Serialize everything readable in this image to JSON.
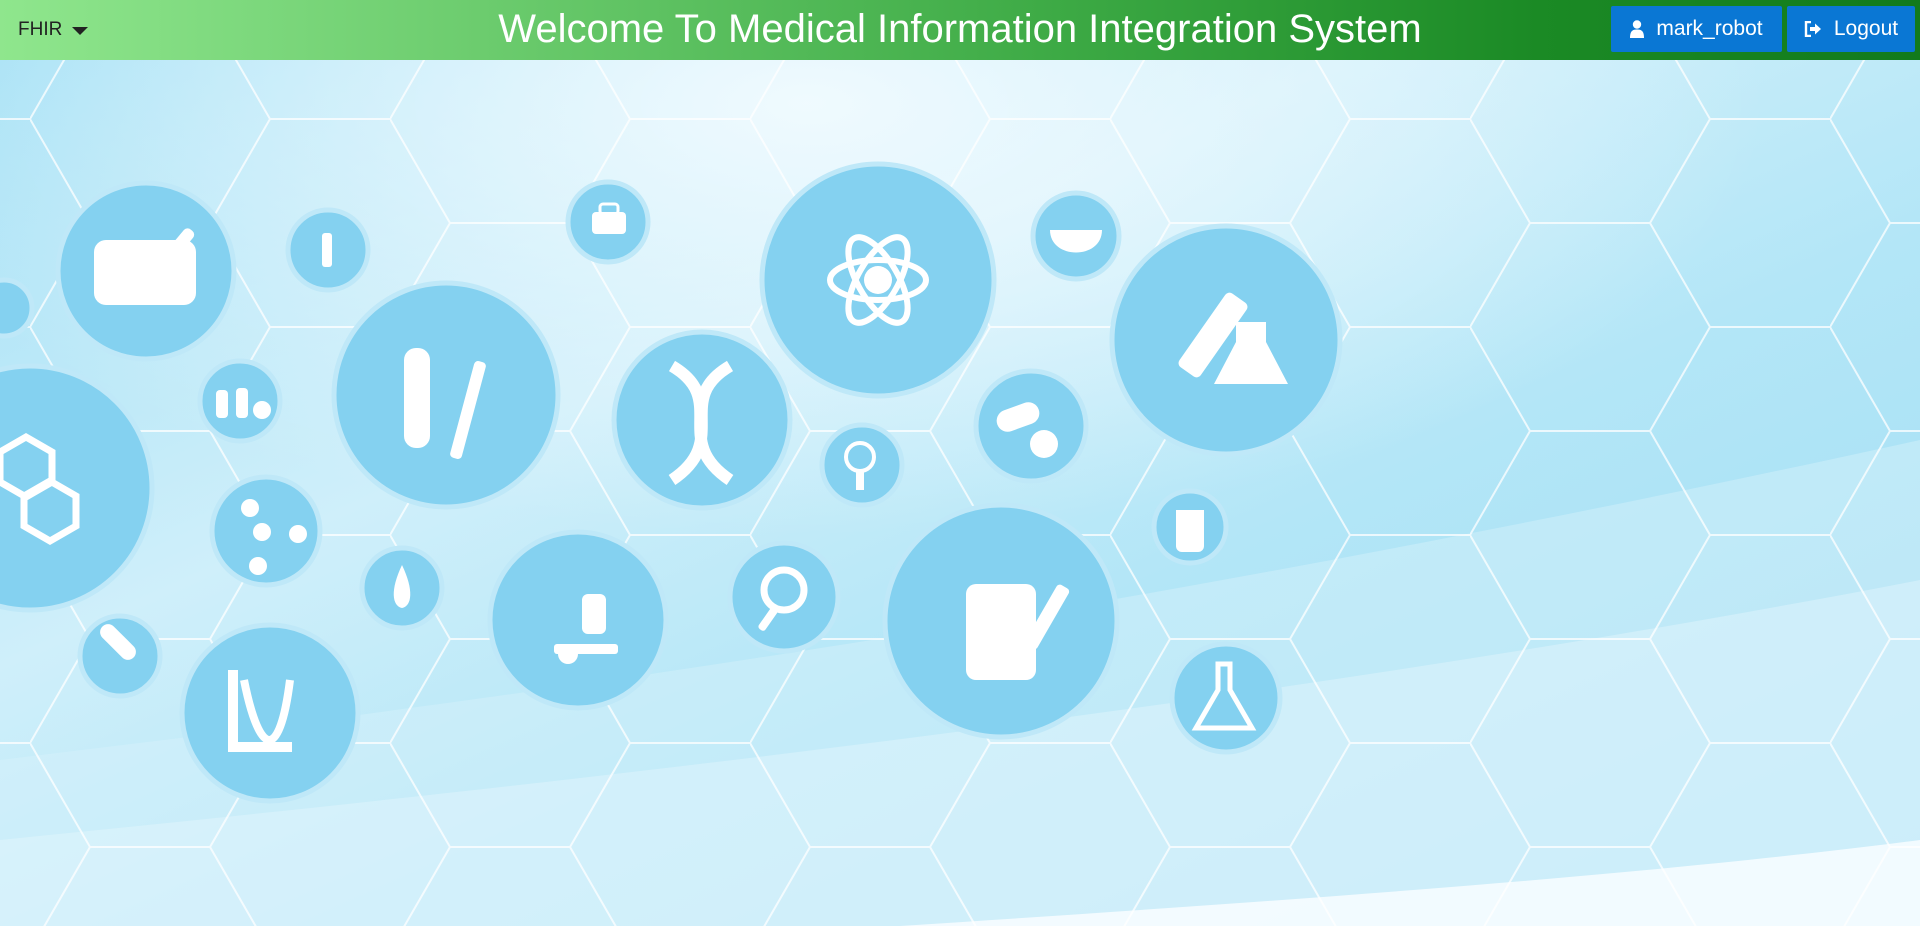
{
  "header": {
    "menu_label": "FHIR",
    "title": "Welcome To Medical Information Integration System",
    "user_label": "mark_robot",
    "logout_label": "Logout"
  },
  "icons": {
    "menu": "chevron-down-icon",
    "user": "user-icon",
    "logout": "sign-out-icon"
  },
  "colors": {
    "header_gradient_start": "#8fe68d",
    "header_gradient_end": "#127a1c",
    "button_blue": "#0a77d4",
    "background_light_blue": "#a9e3f7"
  }
}
